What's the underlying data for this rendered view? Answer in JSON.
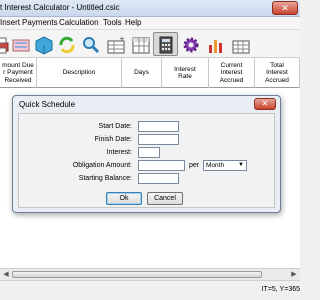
{
  "window": {
    "title": "t Interest Calculator - Untitled.csic",
    "close_glyph": "✕"
  },
  "menu": [
    "Insert",
    "Payments",
    "Calculation",
    "Tools",
    "Help"
  ],
  "toolbar": {
    "icons": [
      "print-icon",
      "tag-icon",
      "box-icon",
      "refresh-icon",
      "search-icon",
      "add-row-icon",
      "table-icon",
      "calculator-icon",
      "gear-icon",
      "chart-icon",
      "grid-icon"
    ]
  },
  "grid": {
    "columns": [
      "mount Due\nr Payment\nReceived",
      "Description",
      "Days",
      "Interest\nRate",
      "Current\nInterest\nAccrued",
      "Total\nInterest\nAccrued"
    ]
  },
  "dialog": {
    "title": "Quick Schedule",
    "close_glyph": "✕",
    "fields": {
      "start_date": {
        "label": "Start Date:",
        "value": ""
      },
      "finish_date": {
        "label": "Finish Date:",
        "value": ""
      },
      "interest": {
        "label": "Interest:",
        "value": ""
      },
      "obligation_amount": {
        "label": "Obligation Amount:",
        "value": ""
      },
      "starting_balance": {
        "label": "Starting Balance:",
        "value": ""
      }
    },
    "per_label": "per",
    "period_selected": "Month",
    "ok_label": "Ok",
    "cancel_label": "Cancel"
  },
  "scrollbar": {
    "left_arrow": "◀",
    "right_arrow": "▶"
  },
  "status": {
    "coords": "IT=5, Y=365"
  }
}
